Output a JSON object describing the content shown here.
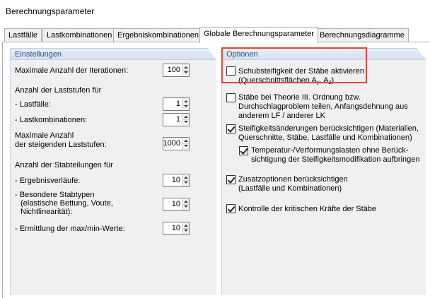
{
  "window": {
    "title": "Berechnungsparameter"
  },
  "tabs": [
    {
      "label": "Lastfälle"
    },
    {
      "label": "Lastkombinationen"
    },
    {
      "label": "Ergebniskombinationen"
    },
    {
      "label": "Globale Berechnungsparameter"
    },
    {
      "label": "Berechnungsdiagramme"
    }
  ],
  "active_tab": "Globale Berechnungsparameter",
  "einstellungen": {
    "header": "Einstellungen",
    "max_iterations_label": "Maximale Anzahl der Iterationen:",
    "max_iterations_value": "100",
    "laststufen_heading": "Anzahl der Laststufen für",
    "lastfaelle_label": "- Lastfälle:",
    "lastfaelle_value": "1",
    "lastkombinationen_label": "- Lastkombinationen:",
    "lastkombinationen_value": "1",
    "steigende_label_1": "Maximale Anzahl",
    "steigende_label_2": "der steigenden Laststufen:",
    "steigende_value": "1000",
    "stabteilungen_heading": "Anzahl der Stabteilungen für",
    "ergebnisverlaeufe_label": "- Ergebnisverläufe:",
    "ergebnisverlaeufe_value": "10",
    "besondere_label_1": "- Besondere Stabtypen",
    "besondere_label_2": "(elastische Bettung, Voute,",
    "besondere_label_3": "Nichtlinearität):",
    "besondere_value": "10",
    "maxmin_label": "- Ermittlung der max/min-Werte:",
    "maxmin_value": "10"
  },
  "optionen": {
    "header": "Optionen",
    "schub_line1": "Schubsteifigkeit der Stäbe aktivieren",
    "schub_line2_prefix": "(Querschnittsflächen A",
    "schub_sub_y": "y",
    "schub_sep": ", A",
    "schub_sub_z": "z",
    "schub_close": ")",
    "schub_checked": false,
    "theorie_line1": "Stäbe bei Theorie III. Ordnung bzw.",
    "theorie_line2": "Durchschlagproblem teilen, Anfangsdehnung aus",
    "theorie_line3": "anderem LF / anderer LK",
    "theorie_checked": false,
    "steif_line1": "Steifigkeitsänderungen berücksichtigen (Materialien,",
    "steif_line2": "Querschnitte, Stäbe, Lastfälle und Kombinationen)",
    "steif_checked": true,
    "temp_line1": "Temperatur-/Verformungslasten ohne Berück-",
    "temp_line2": "sichtigung der Steifigkeitsmodifikation aufbringen",
    "temp_checked": true,
    "zusatz_line1": "Zusatzoptionen berücksichtigen",
    "zusatz_line2": "(Lastfälle und Kombinationen)",
    "zusatz_checked": true,
    "kontrolle_label": "Kontrolle der kritischen Kräfte der Stäbe",
    "kontrolle_checked": true
  },
  "colors": {
    "group_header_text": "#254e86",
    "group_background": "#f0f0f0",
    "highlight_border": "#e0463a"
  }
}
